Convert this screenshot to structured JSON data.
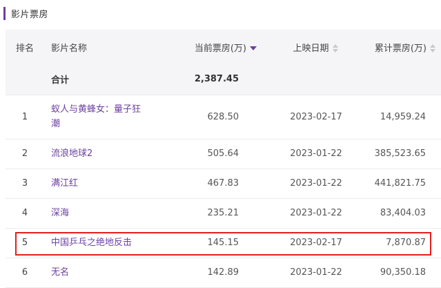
{
  "section": {
    "title": "影片票房"
  },
  "table": {
    "headers": {
      "rank": "排名",
      "name": "影片名称",
      "current": "当前票房(万)",
      "date": "上映日期",
      "total": "累计票房(万)"
    },
    "sort_active_column": "current",
    "total_row": {
      "label": "合计",
      "current": "2,387.45"
    },
    "rows": [
      {
        "rank": "1",
        "name": "蚁人与黄蜂女：量子狂潮",
        "current": "628.50",
        "date": "2023-02-17",
        "total": "14,959.24"
      },
      {
        "rank": "2",
        "name": "流浪地球2",
        "current": "505.64",
        "date": "2023-01-22",
        "total": "385,523.65"
      },
      {
        "rank": "3",
        "name": "满江红",
        "current": "467.83",
        "date": "2023-01-22",
        "total": "441,821.75"
      },
      {
        "rank": "4",
        "name": "深海",
        "current": "235.21",
        "date": "2023-01-22",
        "total": "83,404.03"
      },
      {
        "rank": "5",
        "name": "中国乒乓之绝地反击",
        "current": "145.15",
        "date": "2023-02-17",
        "total": "7,870.87"
      },
      {
        "rank": "6",
        "name": "无名",
        "current": "142.89",
        "date": "2023-01-22",
        "total": "90,350.18"
      }
    ],
    "highlighted_rank": "5"
  },
  "colors": {
    "accent": "#6b3fa0",
    "highlight_border": "#e01e1e",
    "header_bg": "#f5f5f8"
  }
}
